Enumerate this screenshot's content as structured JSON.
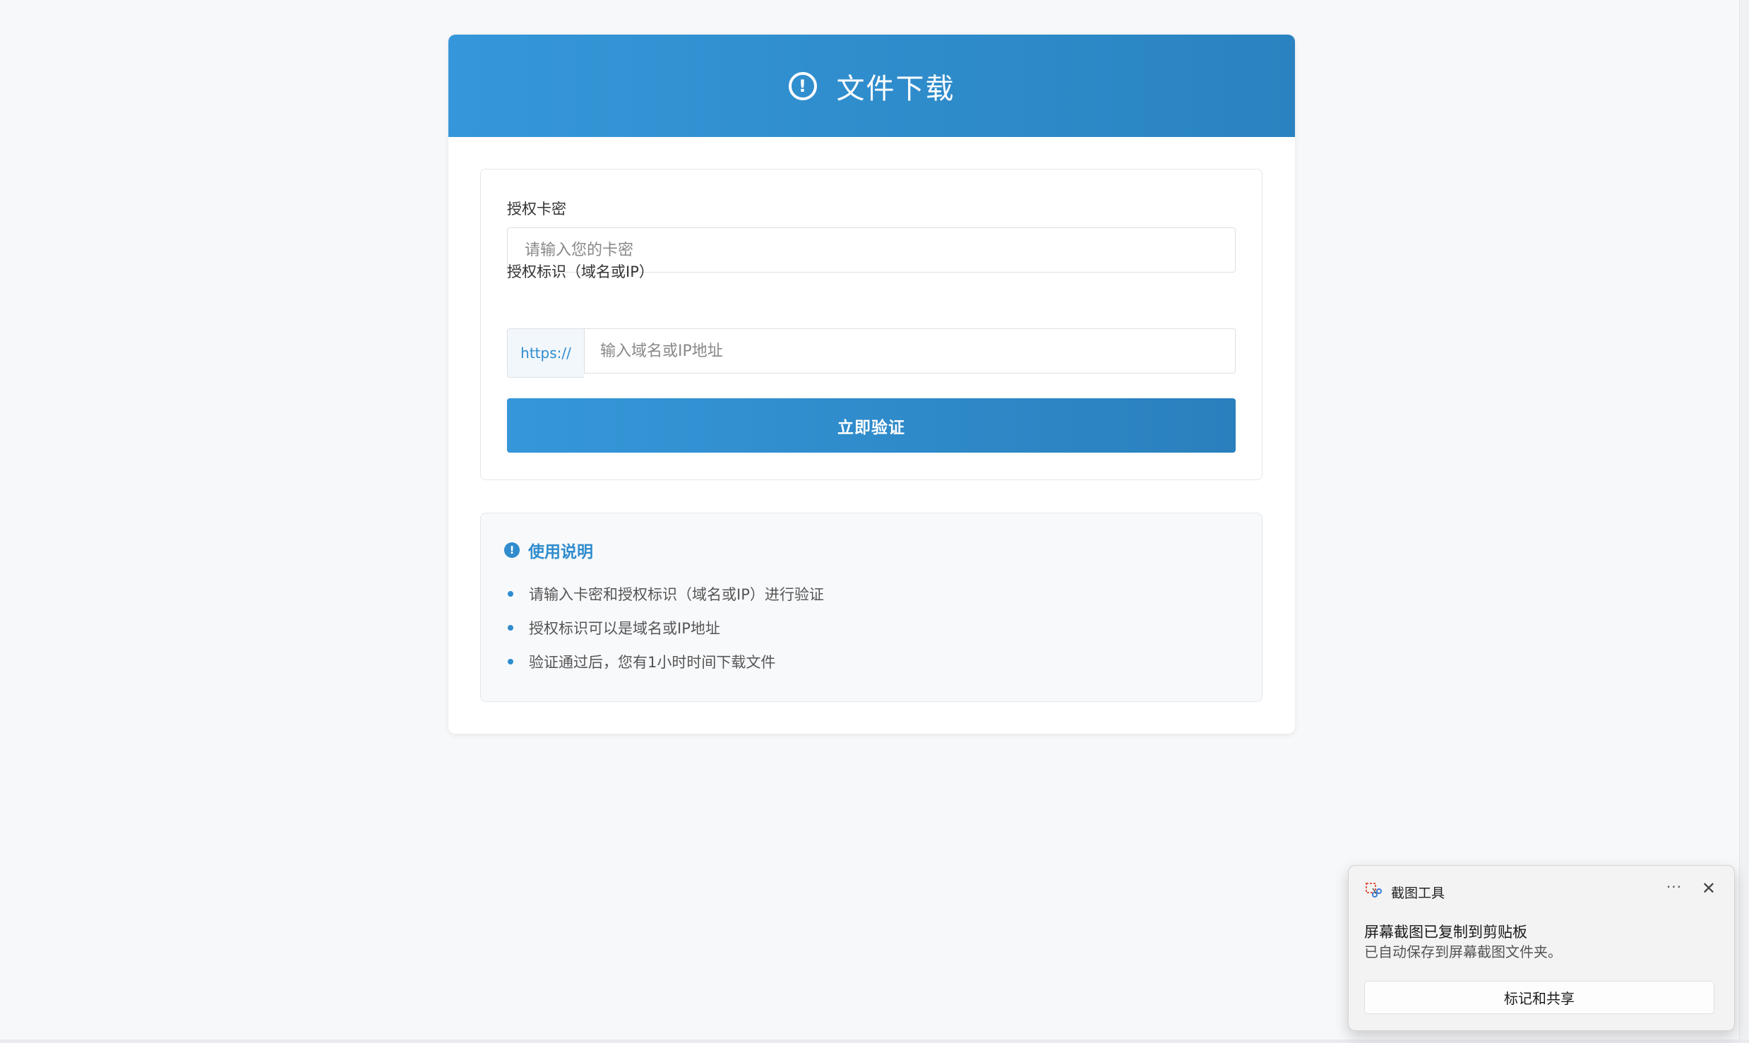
{
  "header": {
    "icon": "exclamation-circle-icon",
    "title": "文件下载"
  },
  "form": {
    "card_key_label": "授权卡密",
    "card_key_placeholder": "请输入您的卡密",
    "card_key_value": "",
    "auth_id_label": "授权标识（域名或IP）",
    "protocol_prefix": "https://",
    "auth_id_placeholder": "输入域名或IP地址",
    "auth_id_value": "",
    "submit_label": "立即验证"
  },
  "instructions": {
    "icon": "info-circle-icon",
    "title": "使用说明",
    "items": [
      "请输入卡密和授权标识（域名或IP）进行验证",
      "授权标识可以是域名或IP地址",
      "验证通过后，您有1小时时间下载文件"
    ]
  },
  "notification": {
    "app_icon": "snipping-tool-icon",
    "app_name": "截图工具",
    "more_label": "···",
    "close_icon": "close-icon",
    "title": "屏幕截图已复制到剪贴板",
    "body": "已自动保存到屏幕截图文件夹。",
    "action_label": "标记和共享"
  },
  "colors": {
    "accent": "#3597d9",
    "accent_dark": "#2a83c0",
    "background": "#f7f8fa"
  }
}
